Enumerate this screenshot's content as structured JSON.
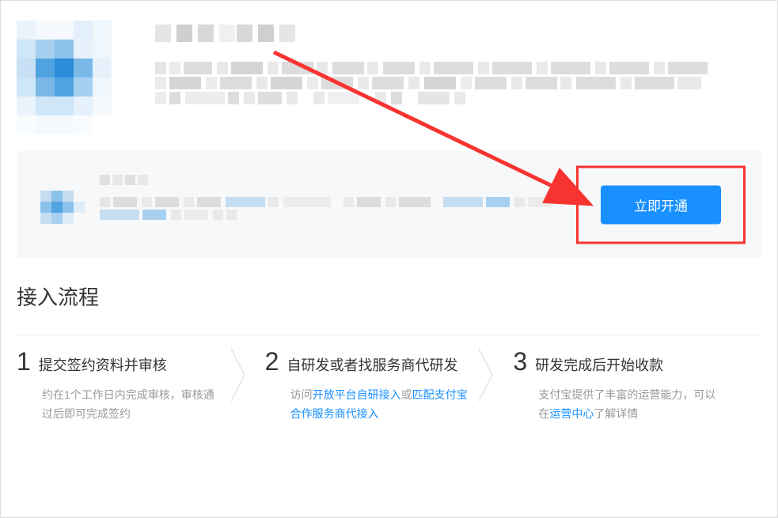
{
  "action_button": "立即开通",
  "flow": {
    "title": "接入流程",
    "steps": [
      {
        "number": "1",
        "label": "提交签约资料并审核",
        "desc_prefix": "约在1个工作日内完成审核，审核通过后即可完成签约",
        "links": []
      },
      {
        "number": "2",
        "label": "自研发或者找服务商代研发",
        "desc_prefix": "访问",
        "desc_link1": "开放平台自研接入",
        "desc_mid": "或",
        "desc_link2": "匹配支付宝合作服务商代接入"
      },
      {
        "number": "3",
        "label": "研发完成后开始收款",
        "desc_prefix": "支付宝提供了丰富的运营能力，可以在",
        "desc_link1": "运营中心",
        "desc_suffix": "了解详情"
      }
    ]
  }
}
